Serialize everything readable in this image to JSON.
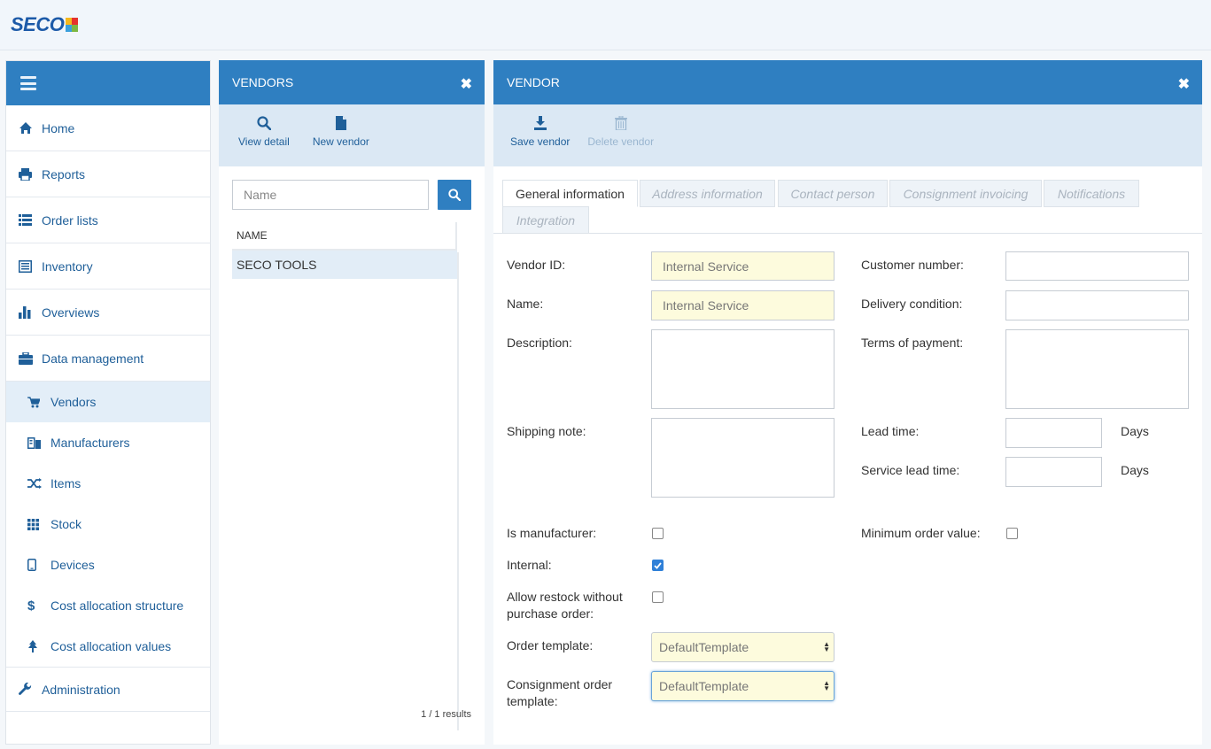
{
  "brand": {
    "logo_text": "SECO"
  },
  "sidebar": {
    "items": [
      {
        "label": "Home",
        "icon": "home-icon"
      },
      {
        "label": "Reports",
        "icon": "print-icon"
      },
      {
        "label": "Order lists",
        "icon": "list-icon"
      },
      {
        "label": "Inventory",
        "icon": "inventory-icon"
      },
      {
        "label": "Overviews",
        "icon": "bar-chart-icon"
      },
      {
        "label": "Data management",
        "icon": "briefcase-icon"
      }
    ],
    "sub_items": [
      {
        "label": "Vendors",
        "icon": "cart-icon",
        "active": true
      },
      {
        "label": "Manufacturers",
        "icon": "manufacturer-icon"
      },
      {
        "label": "Items",
        "icon": "shuffle-icon"
      },
      {
        "label": "Stock",
        "icon": "grid-icon"
      },
      {
        "label": "Devices",
        "icon": "mobile-icon"
      },
      {
        "label": "Cost allocation structure",
        "icon": "dollar-icon"
      },
      {
        "label": "Cost allocation values",
        "icon": "tree-icon"
      }
    ],
    "admin": {
      "label": "Administration",
      "icon": "wrench-icon"
    }
  },
  "vendors_panel": {
    "title": "VENDORS",
    "view_detail": "View detail",
    "new_vendor": "New vendor",
    "search_placeholder": "Name",
    "column_header": "NAME",
    "rows": [
      "SECO TOOLS"
    ],
    "results": "1 / 1 results"
  },
  "vendor_panel": {
    "title": "VENDOR",
    "save_vendor": "Save vendor",
    "delete_vendor": "Delete vendor",
    "tabs": [
      "General information",
      "Address information",
      "Contact person",
      "Consignment invoicing",
      "Notifications",
      "Integration"
    ],
    "form": {
      "vendor_id_label": "Vendor ID:",
      "vendor_id_value": "Internal Service",
      "name_label": "Name:",
      "name_value": "Internal Service",
      "description_label": "Description:",
      "shipping_note_label": "Shipping note:",
      "is_manufacturer_label": "Is manufacturer:",
      "internal_label": "Internal:",
      "allow_restock_label_1": "Allow restock without",
      "allow_restock_label_2": "purchase order:",
      "order_template_label": "Order template:",
      "order_template_value": "DefaultTemplate",
      "consignment_label_1": "Consignment order",
      "consignment_label_2": "template:",
      "consignment_value": "DefaultTemplate",
      "customer_number_label": "Customer number:",
      "delivery_condition_label": "Delivery condition:",
      "terms_label": "Terms of payment:",
      "lead_time_label": "Lead time:",
      "service_lead_time_label": "Service lead time:",
      "days_1": "Days",
      "days_2": "Days",
      "min_order_label": "Minimum order value:",
      "is_manufacturer_checked": false,
      "internal_checked": true,
      "allow_restock_checked": false,
      "min_order_checked": false
    }
  },
  "colors": {
    "primary": "#2f7fc1",
    "toolbar": "#dbe8f4",
    "highlight": "#fdfbdd"
  }
}
